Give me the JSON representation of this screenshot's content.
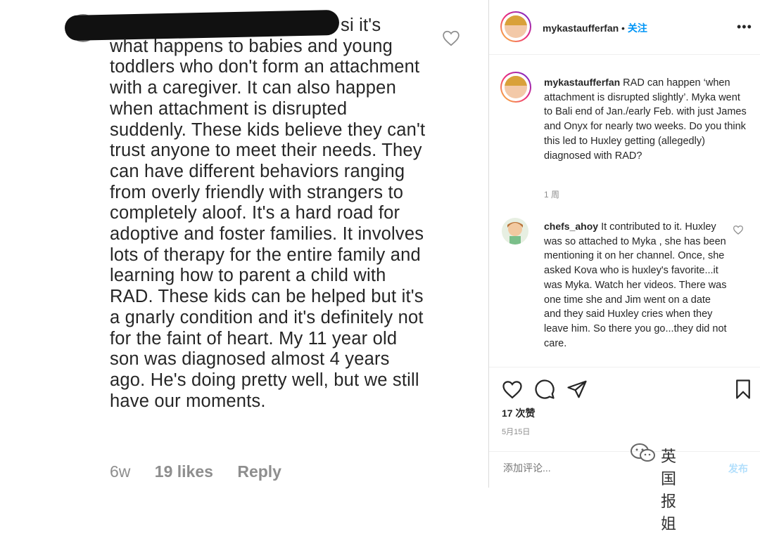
{
  "left": {
    "comment_first": "si it's",
    "comment_body": "what happens to babies and young toddlers who don't form an attachment with a caregiver. It can also happen when attachment is disrupted suddenly. These kids believe they can't trust anyone to meet their needs. They can have different behaviors ranging from overly friendly with strangers to completely aloof. It's a hard road for adoptive and foster families. It involves lots of therapy for the entire family and learning how to parent a child with RAD. These kids can be helped but it's a gnarly condition and it's definitely not for the faint of heart. My 11 year old son was diagnosed almost 4 years ago. He's doing pretty well, but we still have our moments.",
    "age": "6w",
    "likes": "19 likes",
    "reply": "Reply"
  },
  "right": {
    "header": {
      "username": "mykastaufferfan",
      "separator": " • ",
      "follow": "关注",
      "more": "•••"
    },
    "caption": {
      "username": "mykastaufferfan",
      "text": " RAD can happen ‘when attachment is disrupted slightly’. Myka went to Bali end of Jan./early Feb. with just James and Onyx for nearly two weeks. Do you think this led to Huxley getting (allegedly) diagnosed with RAD?",
      "time": "1 周"
    },
    "comment": {
      "username": "chefs_ahoy",
      "text": " It contributed to it. Huxley was so attached to Myka , she has been mentioning it on her channel. Once, she asked Kova who is huxley's favorite...it was Myka. Watch her videos. There was one time she and Jim went on a date and they said Huxley cries when they leave him. So there you go...they did not care."
    },
    "likes": "17 次赞",
    "date": "5月15日",
    "add_comment_placeholder": "添加评论...",
    "post_label": "发布",
    "watermark": "英国报姐"
  },
  "icons": {
    "heart": "heart-icon",
    "comment": "comment-icon",
    "share": "share-icon",
    "bookmark": "bookmark-icon",
    "more": "more-icon",
    "watermark": "wechat-icon"
  },
  "colors": {
    "follow": "#0095f6",
    "text": "#262626",
    "muted": "#8e8e8e",
    "post": "#b2dffc"
  }
}
